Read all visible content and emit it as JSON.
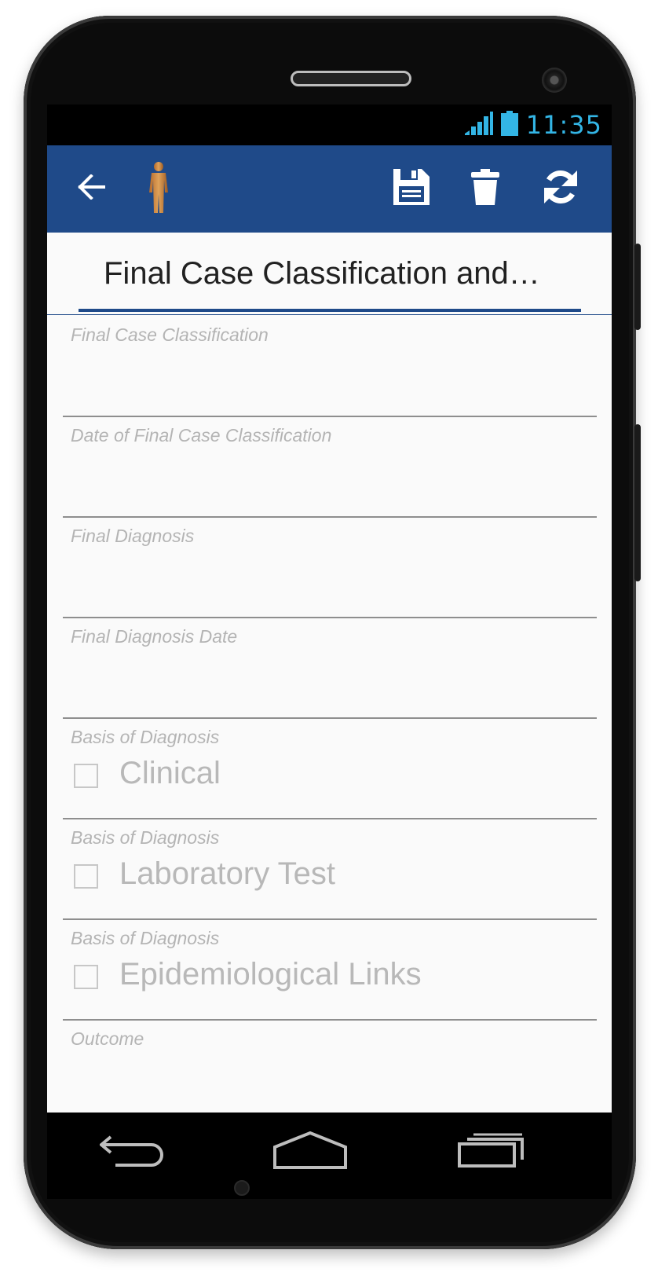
{
  "statusbar": {
    "time": "11:35"
  },
  "toolbar": {
    "back_icon": "arrow-left-icon",
    "person_icon": "person-icon",
    "save_icon": "floppy-disk-icon",
    "delete_icon": "trash-icon",
    "sync_icon": "refresh-icon",
    "color": "#1f4a89"
  },
  "section": {
    "title": "Final Case Classification  and…"
  },
  "form": {
    "fields": [
      {
        "label": "Final Case Classification",
        "value": ""
      },
      {
        "label": "Date of Final Case Classification",
        "value": ""
      },
      {
        "label": "Final Diagnosis",
        "value": ""
      },
      {
        "label": "Final Diagnosis Date",
        "value": ""
      },
      {
        "label": "Basis of Diagnosis",
        "checkbox_label": "Clinical",
        "checked": false
      },
      {
        "label": "Basis of Diagnosis",
        "checkbox_label": "Laboratory Test",
        "checked": false
      },
      {
        "label": "Basis of Diagnosis",
        "checkbox_label": "Epidemiological Links",
        "checked": false
      },
      {
        "label": "Outcome",
        "value": ""
      }
    ]
  },
  "navbar": {
    "back_icon": "nav-back-icon",
    "home_icon": "nav-home-icon",
    "recents_icon": "nav-recents-icon"
  }
}
